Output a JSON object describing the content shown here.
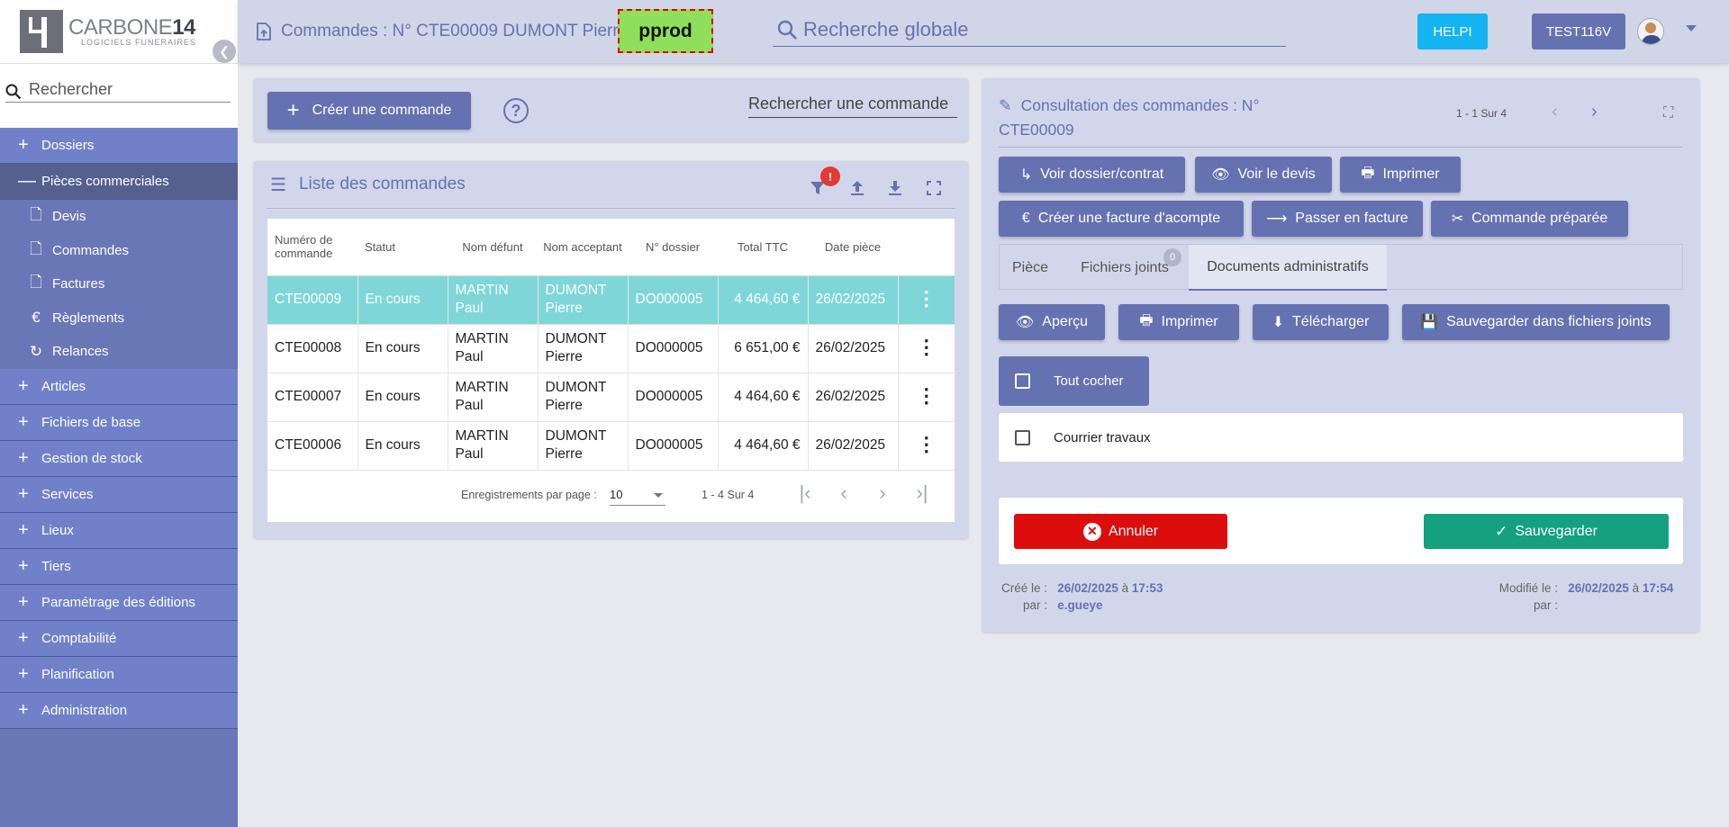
{
  "app": {
    "logo_name": "CARBONE",
    "logo_num": "14",
    "logo_sub": "LOGICIELS FUNERAIRES"
  },
  "sidebar": {
    "search_placeholder": "Rechercher",
    "sections_top": [
      {
        "label": "Dossiers",
        "sign": "+"
      },
      {
        "label": "Pièces commerciales",
        "sign": "—"
      }
    ],
    "sub_items": [
      {
        "label": "Devis",
        "icon": "file-plus-icon",
        "glyph": "🗋"
      },
      {
        "label": "Commandes",
        "icon": "file-upload-icon",
        "glyph": "🗋"
      },
      {
        "label": "Factures",
        "icon": "file-dollar-icon",
        "glyph": "🗋"
      },
      {
        "label": "Règlements",
        "icon": "euro-icon",
        "glyph": "€"
      },
      {
        "label": "Relances",
        "icon": "relance-icon",
        "glyph": "↻"
      }
    ],
    "sections_bottom": [
      {
        "label": "Articles",
        "sign": "+"
      },
      {
        "label": "Fichiers de base",
        "sign": "+"
      },
      {
        "label": "Gestion de stock",
        "sign": "+"
      },
      {
        "label": "Services",
        "sign": "+"
      },
      {
        "label": "Lieux",
        "sign": "+"
      },
      {
        "label": "Tiers",
        "sign": "+"
      },
      {
        "label": "Paramétrage des éditions",
        "sign": "+"
      },
      {
        "label": "Comptabilité",
        "sign": "+"
      },
      {
        "label": "Planification",
        "sign": "+"
      },
      {
        "label": "Administration",
        "sign": "+"
      }
    ]
  },
  "header": {
    "breadcrumb": "Commandes : N° CTE00009 DUMONT Pierre",
    "env": "pprod",
    "search_placeholder": "Recherche globale",
    "help": "HELPI",
    "user": "TEST116V"
  },
  "actions": {
    "create": "Créer une commande",
    "help_glyph": "?",
    "search_placeholder": "Rechercher une commande"
  },
  "list": {
    "title": "Liste des commandes",
    "filter_badge": "!",
    "columns": [
      "Numéro de commande",
      "Statut",
      "Nom défunt",
      "Nom acceptant",
      "N° dossier",
      "Total TTC",
      "Date pièce"
    ],
    "rows": [
      {
        "num": "CTE00009",
        "statut": "En cours",
        "defunt": "MARTIN Paul",
        "acceptant": "DUMONT Pierre",
        "dossier": "DO000005",
        "total": "4 464,60 €",
        "date": "26/02/2025"
      },
      {
        "num": "CTE00008",
        "statut": "En cours",
        "defunt": "MARTIN Paul",
        "acceptant": "DUMONT Pierre",
        "dossier": "DO000005",
        "total": "6 651,00 €",
        "date": "26/02/2025"
      },
      {
        "num": "CTE00007",
        "statut": "En cours",
        "defunt": "MARTIN Paul",
        "acceptant": "DUMONT Pierre",
        "dossier": "DO000005",
        "total": "4 464,60 €",
        "date": "26/02/2025"
      },
      {
        "num": "CTE00006",
        "statut": "En cours",
        "defunt": "MARTIN Paul",
        "acceptant": "DUMONT Pierre",
        "dossier": "DO000005",
        "total": "4 464,60 €",
        "date": "26/02/2025"
      }
    ],
    "pager": {
      "label": "Enregistrements par page :",
      "page_size": "10",
      "range": "1 - 4 Sur 4"
    }
  },
  "detail": {
    "title": "Consultation des commandes : N° CTE00009",
    "count": "1 - 1 Sur 4",
    "buttons": {
      "voir_dossier": "Voir dossier/contrat",
      "voir_devis": "Voir le devis",
      "imprimer": "Imprimer",
      "facture_acompte": "Créer une facture d'acompte",
      "passer_facture": "Passer en facture",
      "commande_preparee": "Commande préparée"
    },
    "tabs": {
      "piece": "Pièce",
      "fichiers": "Fichiers joints",
      "fichiers_badge": "0",
      "documents": "Documents administratifs"
    },
    "doc_actions": {
      "apercu": "Aperçu",
      "imprimer": "Imprimer",
      "telecharger": "Télécharger",
      "sauvegarder_fj": "Sauvegarder dans fichiers joints"
    },
    "tout_cocher": "Tout cocher",
    "documents": [
      {
        "label": "Courrier travaux",
        "checked": false
      }
    ],
    "annuler": "Annuler",
    "sauvegarder": "Sauvegarder",
    "meta": {
      "cree_label": "Créé le :",
      "cree_date": "26/02/2025",
      "a": "à",
      "cree_heure": "17:53",
      "par_label": "par :",
      "cree_par": "e.gueye",
      "modifie_label": "Modifié le :",
      "modifie_date": "26/02/2025",
      "modifie_heure": "17:54",
      "modifie_par": ""
    }
  },
  "colors": {
    "primary": "#6572b1",
    "sidebar": "#6a77b6",
    "selected_row": "#7fd6d8",
    "danger": "#dc0d0d",
    "success": "#15a080",
    "help": "#14b4f0",
    "env_badge": "#8fde5c"
  }
}
